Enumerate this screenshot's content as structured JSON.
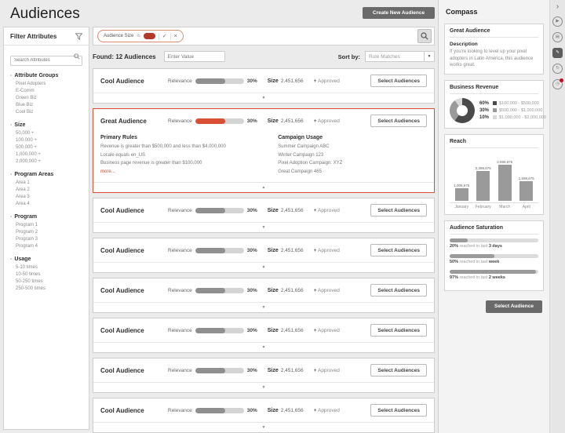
{
  "page": {
    "title": "Audiences",
    "create_button": "Create New Audience"
  },
  "colors": {
    "accent": "#d94f35",
    "value_pill": "#b5382a",
    "dark_button": "#6a6a6a",
    "badge": "#d0021b"
  },
  "icons": {
    "expand": "▼",
    "collapse": "▲",
    "sort_caret": "▼",
    "check": "✓",
    "remove": "×",
    "approved": "+",
    "panel_chevron": "›"
  },
  "filter_panel": {
    "title": "Filter Attributes",
    "search_placeholder": "Search Attributes",
    "groups": [
      {
        "label": "Attribute Groups",
        "items": [
          "Pixel Adopters",
          "E-Comm",
          "Green Biz",
          "Blue Biz",
          "Cool Biz"
        ]
      },
      {
        "label": "Size",
        "items": [
          "50,000 +",
          "100,000 +",
          "500,000 +",
          "1,000,000 +",
          "2,000,000 +"
        ]
      },
      {
        "label": "Program Areas",
        "items": [
          "Area 1",
          "Area 2",
          "Area 3",
          "Area 4"
        ]
      },
      {
        "label": "Program",
        "items": [
          "Program 1",
          "Program 2",
          "Program 3",
          "Program 4"
        ]
      },
      {
        "label": "Usage",
        "items": [
          "5-10 times",
          "10-50 times",
          "50-250 times",
          "250-500 times"
        ]
      }
    ]
  },
  "filter_bar": {
    "chip": {
      "attribute": "Audience Size",
      "operator": "is"
    }
  },
  "results_bar": {
    "found_label": "Found: 12 Audiences",
    "value_placeholder": "Enter Value",
    "sort_label": "Sort by:",
    "sort_value": "Rule Matches"
  },
  "list": {
    "relevance_label": "Relevance",
    "size_label": "Size",
    "approved_label": "Approved",
    "approved_icon": "+",
    "select_button": "Select Audiences",
    "rows": [
      {
        "name": "Cool Audience",
        "relevance_pct": "30%",
        "size": "2,451,656",
        "expanded": false
      },
      {
        "name": "Great Audience",
        "relevance_pct": "30%",
        "size": "2,451,656",
        "expanded": true,
        "primary_rules_title": "Primary Rules",
        "primary_rules": [
          "Revenue is greater than $500,000 and less than $4,000,000",
          "Locale equals en_US",
          "Business page revenue is greater than $100,000"
        ],
        "more_link": "more...",
        "campaign_title": "Campaign Usage",
        "campaigns": [
          "Summer Campaign ABC",
          "Winter Campaign 123",
          "Pixel Adoption Campaign: XYZ",
          "Great Campaign 465"
        ]
      },
      {
        "name": "Cool Audience",
        "relevance_pct": "30%",
        "size": "2,451,656",
        "expanded": false
      },
      {
        "name": "Cool Audience",
        "relevance_pct": "30%",
        "size": "2,451,656",
        "expanded": false
      },
      {
        "name": "Cool Audience",
        "relevance_pct": "30%",
        "size": "2,451,656",
        "expanded": false
      },
      {
        "name": "Cool Audience",
        "relevance_pct": "30%",
        "size": "2,451,656",
        "expanded": false
      },
      {
        "name": "Cool Audience",
        "relevance_pct": "30%",
        "size": "2,451,656",
        "expanded": false
      },
      {
        "name": "Cool Audience",
        "relevance_pct": "30%",
        "size": "2,451,656",
        "expanded": false
      }
    ]
  },
  "compass": {
    "title": "Compass",
    "audience_card": {
      "title": "Great Audience",
      "description_label": "Description",
      "description": "If you're looking to level up your pixel adopters in Latin America, this audience works great."
    },
    "revenue_title": "Business Revenue",
    "reach_title": "Reach",
    "saturation_title": "Audience Saturation",
    "select_button": "Select Audience"
  },
  "rail": {
    "chevron": "›",
    "icons": [
      {
        "name": "play-icon",
        "glyph": "▶"
      },
      {
        "name": "stats-icon",
        "glyph": "▤"
      },
      {
        "name": "notes-icon",
        "glyph": "✎",
        "active": true
      },
      {
        "name": "history-icon",
        "glyph": "↻"
      },
      {
        "name": "alerts-icon",
        "glyph": "◷",
        "badge": true
      }
    ]
  },
  "chart_data": [
    {
      "type": "pie",
      "title": "Business Revenue",
      "values": [
        60,
        30,
        10
      ],
      "labels": [
        "$100,000 - $500,000",
        "$500,000 - $1,000,000",
        "$1,000,000 - $2,000,000"
      ],
      "colors": [
        "#4a4a4a",
        "#9a9a9a",
        "#d8d8d8"
      ],
      "legend_position": "right"
    },
    {
      "type": "bar",
      "title": "Reach",
      "categories": [
        "January",
        "February",
        "March",
        "April"
      ],
      "values": [
        1006675,
        2398675,
        2898675,
        1598675
      ],
      "value_labels": [
        "1,006,675",
        "2,398,675",
        "2,898,675",
        "1,598,675"
      ],
      "ylim": [
        0,
        3000000
      ],
      "grid": false
    },
    {
      "type": "bar",
      "title": "Audience Saturation",
      "orientation": "horizontal",
      "items": [
        {
          "value": 20,
          "pct": "20%",
          "text": "reached in last",
          "period": "3 days"
        },
        {
          "value": 50,
          "pct": "50%",
          "text": "reached in last",
          "period": "week"
        },
        {
          "value": 97,
          "pct": "97%",
          "text": "reached in last",
          "period": "2 weeks"
        }
      ]
    }
  ]
}
